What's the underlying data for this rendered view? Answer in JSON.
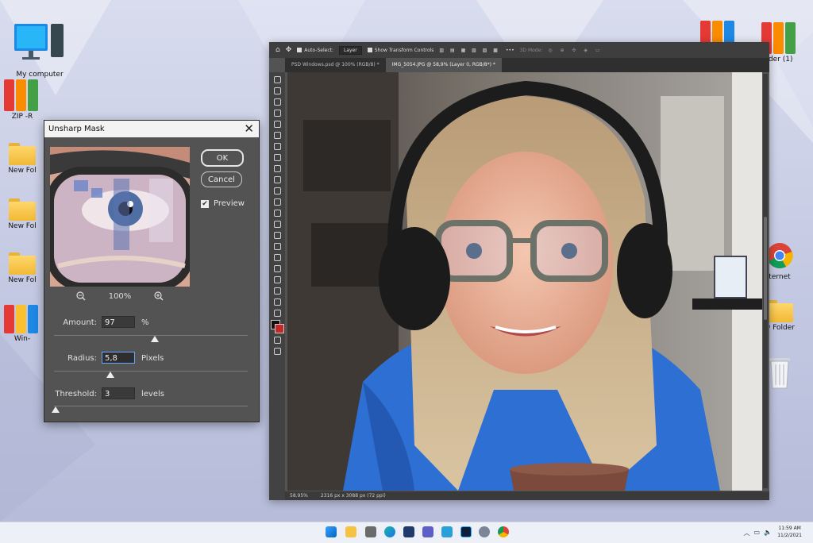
{
  "desktop": {
    "left_icons": [
      {
        "label": "My computer"
      },
      {
        "label": "ZIP -R"
      },
      {
        "label": "New Fol"
      },
      {
        "label": "New Fol"
      },
      {
        "label": "New Fol"
      },
      {
        "label": "Win-"
      }
    ],
    "right_icons": [
      {
        "label": ""
      },
      {
        "label": "lder (1)"
      },
      {
        "label": "ternet"
      },
      {
        "label": "w Folder"
      },
      {
        "label": ""
      }
    ]
  },
  "photoshop": {
    "options_bar": {
      "auto_select_label": "Auto-Select:",
      "layer_select": "Layer",
      "transform_label": "Show Transform Controls",
      "mode_label": "3D Mode:"
    },
    "tabs": [
      {
        "label": "PSD Windows.psd @ 100% (RGB/8) *"
      },
      {
        "label": "IMG_5054.JPG @ 58,9% (Layer 0, RGB/8*) *"
      }
    ],
    "status": {
      "zoom": "58.95%",
      "doc_info": "2316 px x 3088 px (72 ppi)"
    }
  },
  "dialog": {
    "title": "Unsharp Mask",
    "ok_label": "OK",
    "cancel_label": "Cancel",
    "preview_label": "Preview",
    "preview_checked": true,
    "zoom_level": "100%",
    "params": [
      {
        "label": "Amount:",
        "value": "97",
        "unit": "%",
        "slider_fraction": 0.52
      },
      {
        "label": "Radius:",
        "value": "5,8",
        "unit": "Pixels",
        "slider_fraction": 0.29
      },
      {
        "label": "Threshold:",
        "value": "3",
        "unit": "levels",
        "slider_fraction": 0.01
      }
    ]
  },
  "taskbar": {
    "time": "11:59 AM",
    "date": "11/2/2021"
  },
  "colors": {
    "ps_panel": "#535353",
    "ps_dark": "#3e3e3e",
    "accent_blue": "#0078d4",
    "hoodie_blue": "#2e6fd3",
    "folder_yellow": "#f1b936"
  }
}
